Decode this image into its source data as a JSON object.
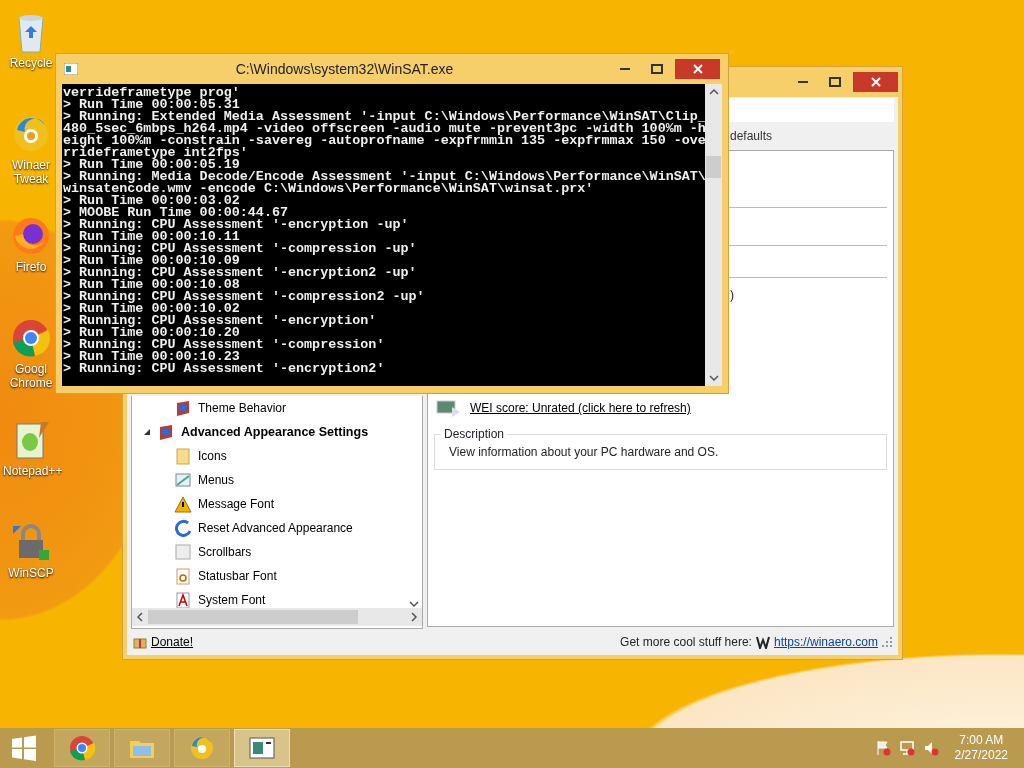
{
  "desktop_icons": [
    {
      "label": "Recycle"
    },
    {
      "label": "Winaer Tweak"
    },
    {
      "label": "Firefo"
    },
    {
      "label": "Googl Chrome"
    },
    {
      "label": "Notepad++"
    },
    {
      "label": "WinSCP"
    }
  ],
  "back_window": {
    "toolbar_fragment": "defaults",
    "text_fragment": ")",
    "tree": [
      {
        "children": [
          {
            "label": "Theme Behavior"
          }
        ]
      },
      {
        "label": "Advanced Appearance Settings",
        "expanded": true,
        "children": [
          {
            "label": "Icons"
          },
          {
            "label": "Menus"
          },
          {
            "label": "Message Font"
          },
          {
            "label": "Reset Advanced Appearance"
          },
          {
            "label": "Scrollbars"
          },
          {
            "label": "Statusbar Font"
          },
          {
            "label": "System Font"
          }
        ]
      }
    ],
    "wei_link": "WEI score: Unrated (click here to refresh)",
    "description": {
      "title": "Description",
      "text": "View information about your PC hardware and OS."
    },
    "status": {
      "donate": "Donate!",
      "promo": "Get more cool stuff here:",
      "url": "https://winaero.com"
    }
  },
  "console": {
    "title": "C:\\Windows\\system32\\WinSAT.exe",
    "lines": [
      "verrideframetype prog'",
      "> Run Time 00:00:05.31",
      "> Running: Extended Media Assessment '-input C:\\Windows\\Performance\\WinSAT\\Clip_",
      "480_5sec_6mbps_h264.mp4 -video offscreen -audio mute -prevent3pc -width 100%m -h",
      "eight 100%m -constrain -savereg -autoprofname -expfrmmin 135 -expfrmmax 150 -ove",
      "rrideframetype int2fps'",
      "> Run Time 00:00:05.19",
      "> Running: Media Decode/Encode Assessment '-input C:\\Windows\\Performance\\WinSAT\\",
      "winsatencode.wmv -encode C:\\Windows\\Performance\\WinSAT\\winsat.prx'",
      "> Run Time 00:00:03.02",
      "> MOOBE Run Time 00:00:44.67",
      "> Running: CPU Assessment '-encryption -up'",
      "> Run Time 00:00:10.11",
      "> Running: CPU Assessment '-compression -up'",
      "> Run Time 00:00:10.09",
      "> Running: CPU Assessment '-encryption2 -up'",
      "> Run Time 00:00:10.08",
      "> Running: CPU Assessment '-compression2 -up'",
      "> Run Time 00:00:10.02",
      "> Running: CPU Assessment '-encryption'",
      "> Run Time 00:00:10.20",
      "> Running: CPU Assessment '-compression'",
      "> Run Time 00:00:10.23",
      "> Running: CPU Assessment '-encryption2'"
    ]
  },
  "taskbar": {
    "apps": [
      {
        "selected": false
      },
      {
        "selected": false
      },
      {
        "selected": false
      },
      {
        "selected": true
      }
    ],
    "time": "7:00 AM",
    "date": "2/27/2022"
  }
}
